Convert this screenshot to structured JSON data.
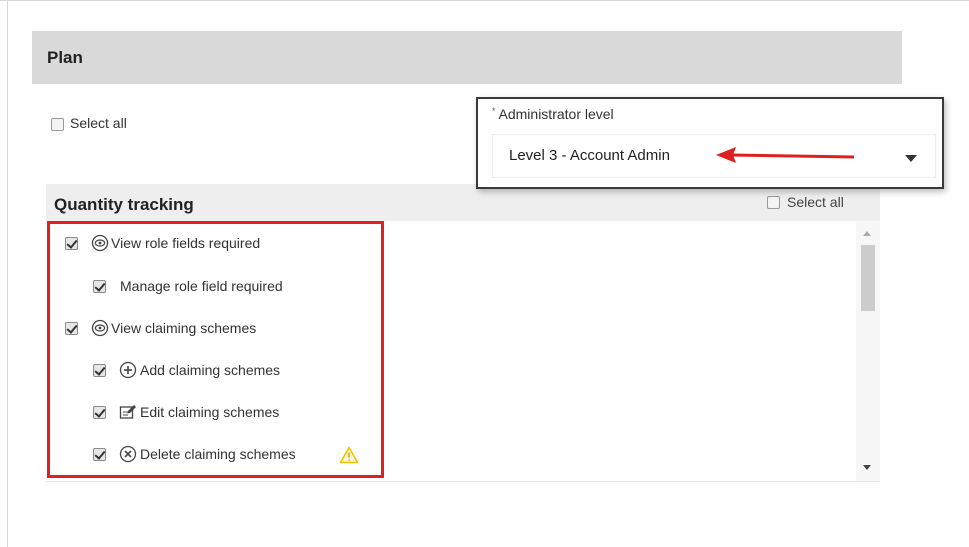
{
  "plan": {
    "title": "Plan"
  },
  "top_select_all": {
    "label": "Select all",
    "checked": false
  },
  "admin": {
    "label": "Administrator level",
    "required_marker": "*",
    "selected_value": "Level 3 - Account Admin"
  },
  "quantity_tracking": {
    "title": "Quantity tracking",
    "select_all_label": "Select all",
    "items": [
      {
        "label": "View role fields required",
        "checked": true,
        "icon": "view-icon",
        "indent": 0
      },
      {
        "label": "Manage role field required",
        "checked": true,
        "icon": "",
        "indent": 1
      },
      {
        "label": "View claiming schemes",
        "checked": true,
        "icon": "view-icon",
        "indent": 0
      },
      {
        "label": "Add claiming schemes",
        "checked": true,
        "icon": "add-icon",
        "indent": 1
      },
      {
        "label": "Edit claiming schemes",
        "checked": true,
        "icon": "edit-icon",
        "indent": 1
      },
      {
        "label": "Delete claiming schemes",
        "checked": true,
        "icon": "delete-icon",
        "indent": 1,
        "warning": true
      }
    ]
  },
  "colors": {
    "highlight": "#e02020",
    "warning": "#f2c200",
    "header_bg": "#d9d9d9"
  }
}
